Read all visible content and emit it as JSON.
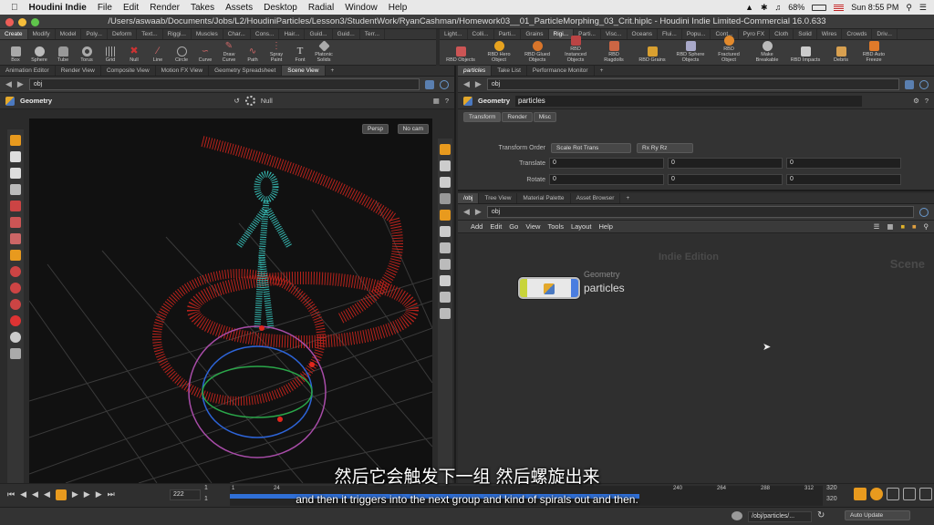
{
  "mac_menu": {
    "apple": "",
    "app": "Houdini Indie",
    "items": [
      "File",
      "Edit",
      "Render",
      "Takes",
      "Assets",
      "Desktop",
      "Radial",
      "Window",
      "Help"
    ],
    "battery": "68%",
    "clock": "Sun 8:55 PM"
  },
  "window_title": "/Users/aswaab/Documents/Jobs/L2/HoudiniParticles/Lesson3/StudentWork/RyanCashman/Homework03__01_ParticleMorphing_03_Crit.hiplc - Houdini Indie Limited-Commercial 16.0.633",
  "left_shelf": {
    "tabs": [
      "Create",
      "Modify",
      "Model",
      "Poly...",
      "Deform",
      "Text...",
      "Riggi...",
      "Muscles",
      "Char...",
      "Cons...",
      "Hair...",
      "Guid...",
      "Guid...",
      "Terr..."
    ],
    "tools": [
      "Box",
      "Sphere",
      "Tube",
      "Torus",
      "Grid",
      "Null",
      "Line",
      "Circle",
      "Curve",
      "Draw Curve",
      "Path",
      "Spray Paint",
      "Font",
      "Platonic Solids"
    ]
  },
  "right_shelf": {
    "tabs": [
      "Light...",
      "Colli...",
      "Parti...",
      "Grains",
      "Rigi...",
      "Parti...",
      "Visc...",
      "Oceans",
      "Flui...",
      "Popu...",
      "Cont...",
      "Pyro FX",
      "Cloth",
      "Solid",
      "Wires",
      "Crowds",
      "Driv..."
    ],
    "tools": [
      "RBD Objects",
      "RBD Hero Object",
      "RBD Glued Objects",
      "RBD Instanced Objects",
      "RBD Ragdolls",
      "RBD Grains",
      "RBD Sphere Objects",
      "RBD Fractured Object",
      "Make Breakable",
      "RBD Impacts",
      "Debris",
      "RBD Auto Freeze"
    ]
  },
  "scene_panel": {
    "tabs": [
      "Animation Editor",
      "Render View",
      "Composite View",
      "Motion FX View",
      "Geometry Spreadsheet",
      "Scene View"
    ],
    "path": "obj",
    "context": "Geometry",
    "selection_mode": "Null",
    "persp": "Persp",
    "cam": "No cam"
  },
  "param_panel": {
    "tabs": [
      "particles",
      "Take List",
      "Performance Monitor"
    ],
    "path": "obj",
    "type": "Geometry",
    "name": "particles",
    "subtabs": [
      "Transform",
      "Render",
      "Misc"
    ],
    "transform_order_label": "Transform Order",
    "transform_order": "Scale Rot Trans",
    "rot_order": "Rx Ry Rz",
    "translate_label": "Translate",
    "translate": [
      "0",
      "0",
      "0"
    ],
    "rotate_label": "Rotate",
    "rotate": [
      "0",
      "0",
      "0"
    ]
  },
  "network_panel": {
    "tabs": [
      "/obj",
      "Tree View",
      "Material Palette",
      "Asset Browser"
    ],
    "path": "obj",
    "menu": [
      "Add",
      "Edit",
      "Go",
      "View",
      "Tools",
      "Layout",
      "Help"
    ],
    "watermark": "Indie Edition",
    "context_label": "Scene",
    "node_type": "Geometry",
    "node_name": "particles"
  },
  "timeline": {
    "current_frame": "222",
    "start": "1",
    "start2": "1",
    "ticks": [
      "1",
      "24",
      "240",
      "264",
      "288",
      "312"
    ],
    "end": "320",
    "end2": "320",
    "progress": 0.69
  },
  "statusbar": {
    "path": "/obj/particles/...",
    "mode": "Auto Update"
  },
  "subtitles": {
    "cn": "然后它会触发下一组 然后螺旋出来",
    "en": "and then it triggers into the next group and kind of spirals out and then."
  },
  "colors": {
    "accent": "#e89a1e",
    "particles_red": "#d6261d",
    "particles_cyan": "#35b7b0",
    "timeline_blue": "#2f6fd6"
  }
}
